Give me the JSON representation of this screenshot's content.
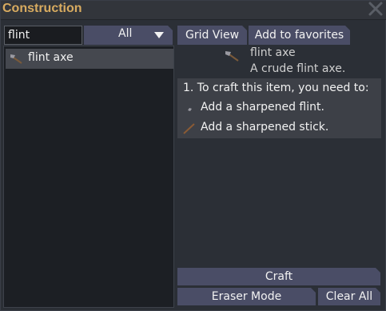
{
  "window": {
    "title": "Construction"
  },
  "filter": {
    "search_value": "flint",
    "category_selected": "All"
  },
  "recipe_list": {
    "items": [
      {
        "label": "flint axe",
        "icon": "flint-axe-icon",
        "selected": true
      }
    ]
  },
  "toolbar": {
    "grid_view_label": "Grid View",
    "add_favorites_label": "Add to favorites"
  },
  "item_detail": {
    "name": "flint axe",
    "description": "A crude flint axe.",
    "icon": "flint-axe-icon"
  },
  "requirements": {
    "header": "1. To craft this item, you need to:",
    "items": [
      {
        "label": "Add a sharpened flint.",
        "icon": "sharpened-flint-icon"
      },
      {
        "label": "Add a sharpened stick.",
        "icon": "sharpened-stick-icon"
      }
    ]
  },
  "actions": {
    "craft_label": "Craft",
    "eraser_label": "Eraser Mode",
    "clear_label": "Clear All"
  },
  "colors": {
    "title": "#d8ab60",
    "button": "#4a4d66",
    "panel": "#1c1f24",
    "selected_row": "#45484f"
  }
}
